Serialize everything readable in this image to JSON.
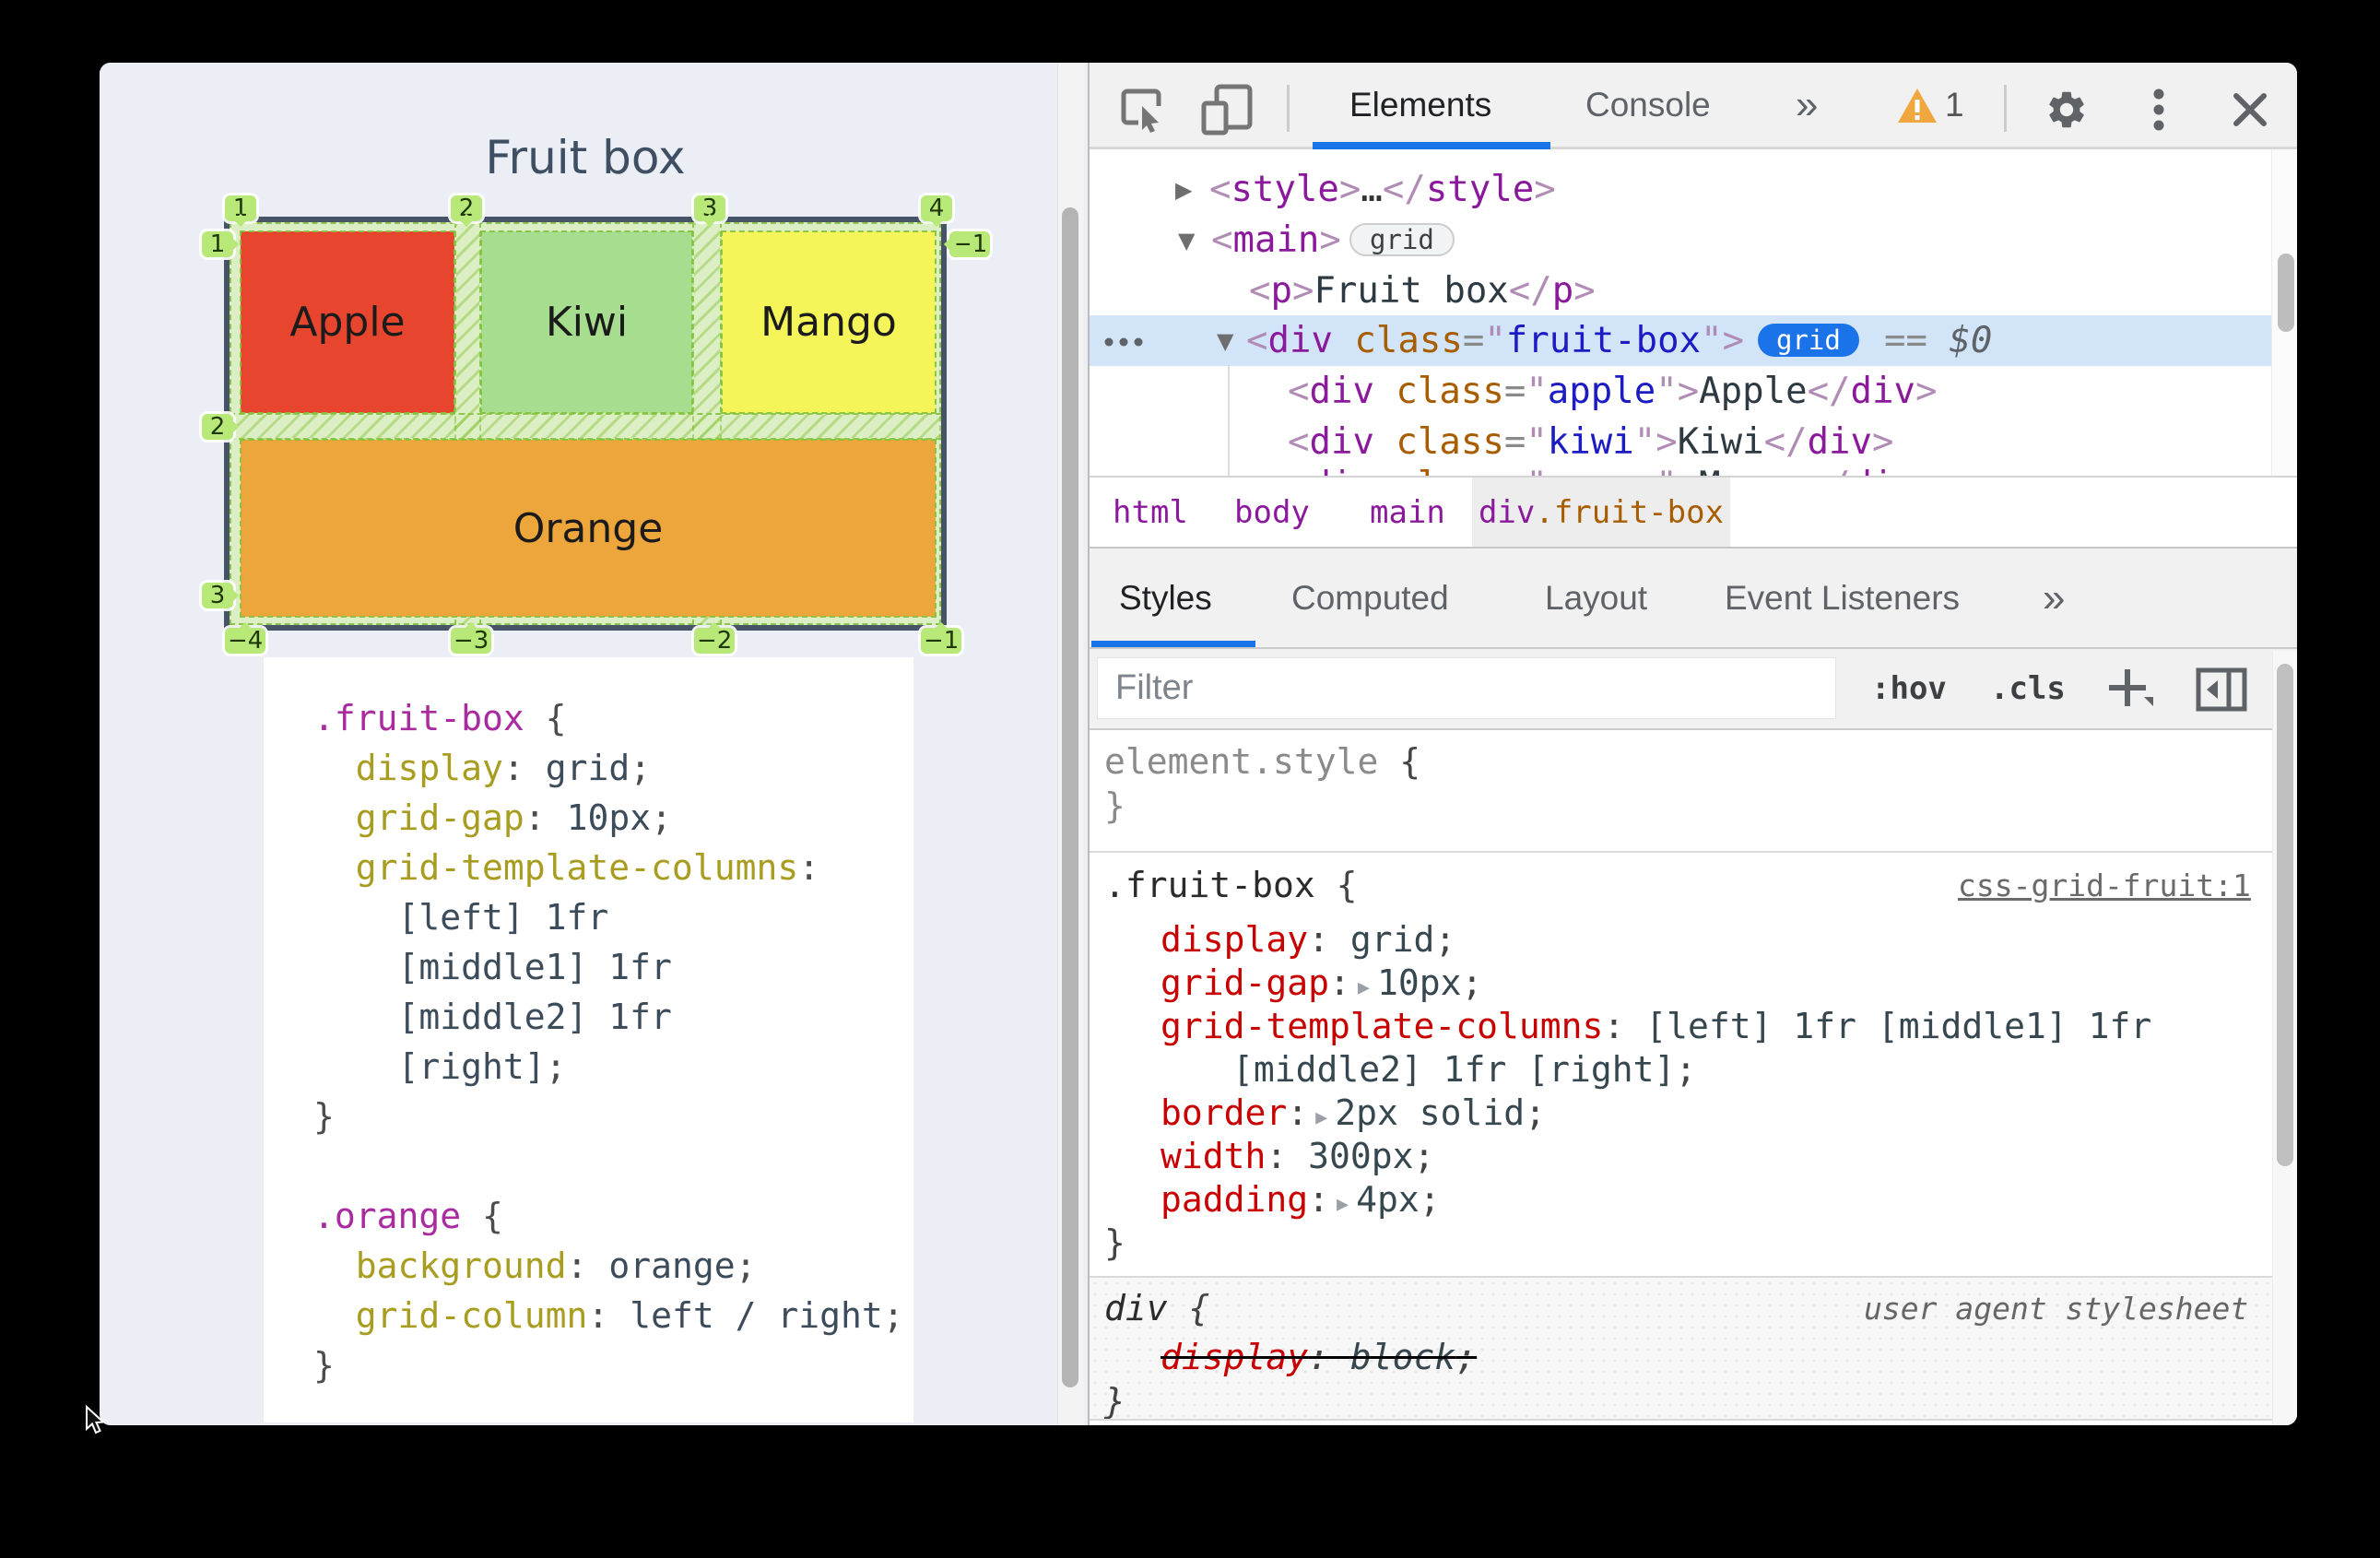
{
  "colors": {
    "accent_blue": "#1a73e8",
    "highlight_row": "#d2e4f8",
    "apple": "#e7452d",
    "kiwi": "#a6dd8e",
    "mango": "#f5f559",
    "orange": "#eda63b",
    "badge_green": "#b7e878",
    "warn_amber": "#f0a73f"
  },
  "preview": {
    "title": "Fruit box",
    "grid": {
      "cells": [
        {
          "name": "apple",
          "label": "Apple",
          "color": "#e7452d"
        },
        {
          "name": "kiwi",
          "label": "Kiwi",
          "color": "#a6dd8e"
        },
        {
          "name": "mango",
          "label": "Mango",
          "color": "#f5f559"
        },
        {
          "name": "orange",
          "label": "Orange",
          "color": "#eda63b"
        }
      ],
      "top_badges": [
        "1",
        "2",
        "3",
        "4"
      ],
      "left_badges": [
        "1",
        "2",
        "3"
      ],
      "right_badges": [
        "−1"
      ],
      "bottom_badges": [
        "−4",
        "−3",
        "−2",
        "−1"
      ]
    },
    "code": {
      "lines": [
        [
          [
            "csel",
            ".fruit-box"
          ],
          [
            "cpun",
            " {"
          ]
        ],
        [
          [
            "cpun",
            "  "
          ],
          [
            "cprop",
            "display"
          ],
          [
            "cpun",
            ": "
          ],
          [
            "cval",
            "grid"
          ],
          [
            "cpun",
            ";"
          ]
        ],
        [
          [
            "cpun",
            "  "
          ],
          [
            "cprop",
            "grid-gap"
          ],
          [
            "cpun",
            ": "
          ],
          [
            "cval",
            "10px"
          ],
          [
            "cpun",
            ";"
          ]
        ],
        [
          [
            "cpun",
            "  "
          ],
          [
            "cprop",
            "grid-template-columns"
          ],
          [
            "cpun",
            ":"
          ]
        ],
        [
          [
            "cval",
            "    [left] 1fr"
          ]
        ],
        [
          [
            "cval",
            "    [middle1] 1fr"
          ]
        ],
        [
          [
            "cval",
            "    [middle2] 1fr"
          ]
        ],
        [
          [
            "cval",
            "    [right]"
          ],
          [
            "cpun",
            ";"
          ]
        ],
        [
          [
            "cpun",
            "}"
          ]
        ],
        [],
        [
          [
            "csel",
            ".orange"
          ],
          [
            "cpun",
            " {"
          ]
        ],
        [
          [
            "cpun",
            "  "
          ],
          [
            "cprop",
            "background"
          ],
          [
            "cpun",
            ": "
          ],
          [
            "cval",
            "orange"
          ],
          [
            "cpun",
            ";"
          ]
        ],
        [
          [
            "cpun",
            "  "
          ],
          [
            "cprop",
            "grid-column"
          ],
          [
            "cpun",
            ": "
          ],
          [
            "cval",
            "left / right"
          ],
          [
            "cpun",
            ";"
          ]
        ],
        [
          [
            "cpun",
            "}"
          ]
        ]
      ]
    }
  },
  "devtools": {
    "toolbar": {
      "tab_elements": "Elements",
      "tab_console": "Console",
      "more": "»",
      "warn_count": "1"
    },
    "dom": {
      "row_style": [
        [
          "pun",
          "<"
        ],
        [
          "tag",
          "style"
        ],
        [
          "pun",
          ">"
        ],
        [
          "dots",
          "…"
        ],
        [
          "pun",
          "</"
        ],
        [
          "tag",
          "style"
        ],
        [
          "pun",
          ">"
        ]
      ],
      "row_main": [
        [
          "pun",
          "<"
        ],
        [
          "tag",
          "main"
        ],
        [
          "pun",
          ">"
        ]
      ],
      "row_p": [
        [
          "pun",
          "<"
        ],
        [
          "tag",
          "p"
        ],
        [
          "pun",
          ">"
        ],
        [
          "txt",
          "Fruit box"
        ],
        [
          "pun",
          "</"
        ],
        [
          "tag",
          "p"
        ],
        [
          "pun",
          ">"
        ]
      ],
      "row_fruitbox": [
        [
          "pun",
          "<"
        ],
        [
          "tag",
          "div"
        ],
        [
          "txt",
          " "
        ],
        [
          "attr",
          "class"
        ],
        [
          "eq",
          "="
        ],
        [
          "quo",
          "\""
        ],
        [
          "str",
          "fruit-box"
        ],
        [
          "quo",
          "\""
        ],
        [
          "pun",
          ">"
        ]
      ],
      "row_fruitbox_suffix": [
        [
          "eq2",
          "== "
        ],
        [
          "dollar",
          "$0"
        ]
      ],
      "row_apple": [
        [
          "pun",
          "<"
        ],
        [
          "tag",
          "div"
        ],
        [
          "txt",
          " "
        ],
        [
          "attr",
          "class"
        ],
        [
          "eq",
          "="
        ],
        [
          "quo",
          "\""
        ],
        [
          "str",
          "apple"
        ],
        [
          "quo",
          "\""
        ],
        [
          "pun",
          ">"
        ],
        [
          "txt",
          "Apple"
        ],
        [
          "pun",
          "</"
        ],
        [
          "tag",
          "div"
        ],
        [
          "pun",
          ">"
        ]
      ],
      "row_kiwi": [
        [
          "pun",
          "<"
        ],
        [
          "tag",
          "div"
        ],
        [
          "txt",
          " "
        ],
        [
          "attr",
          "class"
        ],
        [
          "eq",
          "="
        ],
        [
          "quo",
          "\""
        ],
        [
          "str",
          "kiwi"
        ],
        [
          "quo",
          "\""
        ],
        [
          "pun",
          ">"
        ],
        [
          "txt",
          "Kiwi"
        ],
        [
          "pun",
          "</"
        ],
        [
          "tag",
          "div"
        ],
        [
          "pun",
          ">"
        ]
      ],
      "row_mango": [
        [
          "pun",
          "<"
        ],
        [
          "tag",
          "div"
        ],
        [
          "txt",
          " "
        ],
        [
          "attr",
          "class"
        ],
        [
          "eq",
          "="
        ],
        [
          "quo",
          "\""
        ],
        [
          "str",
          "mango"
        ],
        [
          "quo",
          "\""
        ],
        [
          "pun",
          ">"
        ],
        [
          "txt",
          "Mango"
        ],
        [
          "pun",
          "</"
        ],
        [
          "tag",
          "div"
        ],
        [
          "pun",
          ">"
        ]
      ],
      "grid_badge": "grid",
      "ellipsis": "…"
    },
    "breadcrumbs": {
      "items": [
        "html",
        "body",
        "main"
      ],
      "active": [
        [
          "tag",
          "div"
        ],
        [
          "attr",
          ".fruit-box"
        ]
      ]
    },
    "sidebar_tabs": {
      "styles": "Styles",
      "computed": "Computed",
      "layout": "Layout",
      "event_listeners": "Event Listeners",
      "more": "»"
    },
    "filter": {
      "placeholder": "Filter",
      "hov": ":hov",
      "cls": ".cls"
    },
    "styles": {
      "element_style_open": [
        [
          "gray",
          "element.style"
        ],
        [
          "p2",
          " {"
        ]
      ],
      "element_style_close": [
        [
          "gray",
          "}"
        ]
      ],
      "rule1_link": "css-grid-fruit:1",
      "rule1_open": [
        [
          "sel",
          ".fruit-box"
        ],
        [
          "p2",
          " {"
        ]
      ],
      "p_display": [
        [
          "prop",
          "display"
        ],
        [
          "p2",
          ": "
        ],
        [
          "val",
          "grid"
        ],
        [
          "p2",
          ";"
        ]
      ],
      "p_gridgap": [
        [
          "prop",
          "grid-gap"
        ],
        [
          "p2",
          ":"
        ],
        [
          "tri",
          "� "
        ],
        [
          "val",
          "10px"
        ],
        [
          "p2",
          ";"
        ]
      ],
      "p_gtc1": [
        [
          "prop",
          "grid-template-columns"
        ],
        [
          "p2",
          ": "
        ],
        [
          "val",
          "[left] 1fr [middle1] 1fr"
        ]
      ],
      "p_gtc2": [
        [
          "val",
          "[middle2] 1fr [right]"
        ],
        [
          "p2",
          ";"
        ]
      ],
      "p_border": [
        [
          "prop",
          "border"
        ],
        [
          "p2",
          ":"
        ],
        [
          "tri",
          "� "
        ],
        [
          "val",
          "2px solid"
        ],
        [
          "p2",
          ";"
        ]
      ],
      "p_width": [
        [
          "prop",
          "width"
        ],
        [
          "p2",
          ": "
        ],
        [
          "val",
          "300px"
        ],
        [
          "p2",
          ";"
        ]
      ],
      "p_padding": [
        [
          "prop",
          "padding"
        ],
        [
          "p2",
          ":"
        ],
        [
          "tri",
          "� "
        ],
        [
          "val",
          "4px"
        ],
        [
          "p2",
          ";"
        ]
      ],
      "rule1_close": [
        [
          "p2",
          "}"
        ]
      ],
      "ua_note": "user agent stylesheet",
      "ua_open": [
        [
          "sel",
          "div"
        ],
        [
          "p2",
          " {"
        ]
      ],
      "ua_display": [
        [
          "prop",
          "display"
        ],
        [
          "p2",
          ": "
        ],
        [
          "val",
          "block"
        ],
        [
          "p2",
          ";"
        ]
      ],
      "ua_close": [
        [
          "p2",
          "}"
        ]
      ]
    }
  }
}
